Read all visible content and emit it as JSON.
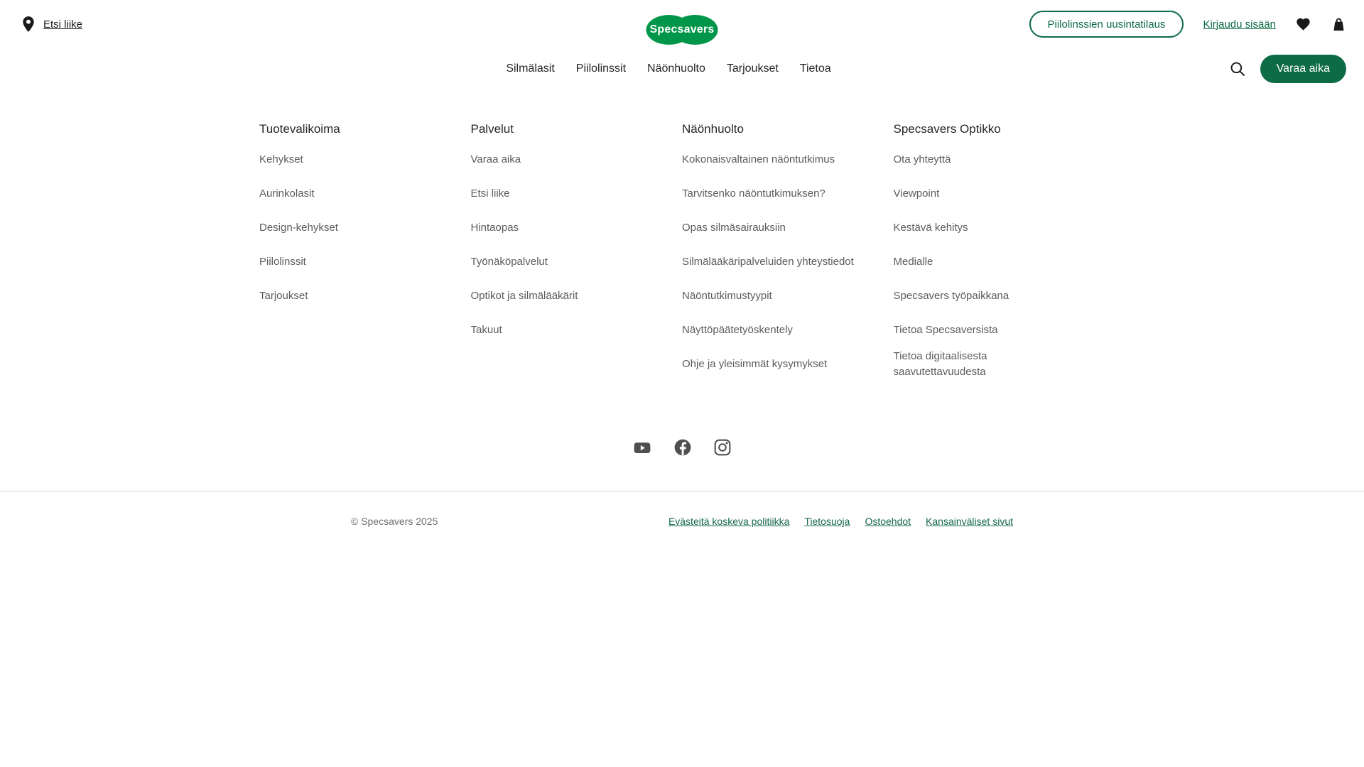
{
  "header": {
    "store_finder_label": "Etsi liike",
    "logo_text": "Specsavers",
    "reorder_button_label": "Piilolinssien uusintatilaus",
    "login_label": "Kirjaudu sisään",
    "nav_items": [
      "Silmälasit",
      "Piilolinssit",
      "Näönhuolto",
      "Tarjoukset",
      "Tietoa"
    ],
    "book_button_label": "Varaa aika"
  },
  "footer": {
    "columns": [
      {
        "title": "Tuotevalikoima",
        "links": [
          "Kehykset",
          "Aurinkolasit",
          "Design-kehykset",
          "Piilolinssit",
          "Tarjoukset"
        ]
      },
      {
        "title": "Palvelut",
        "links": [
          "Varaa aika",
          "Etsi liike",
          "Hintaopas",
          "Työnäköpalvelut",
          "Optikot ja silmälääkärit",
          "Takuut"
        ]
      },
      {
        "title": "Näönhuolto",
        "links": [
          "Kokonaisvaltainen näöntutkimus",
          "Tarvitsenko näöntutkimuksen?",
          "Opas silmäsairauksiin",
          "Silmälääkäripalveluiden yhteystiedot",
          "Näöntutkimustyypit",
          "Näyttöpäätetyöskentely",
          "Ohje ja yleisimmät kysymykset"
        ]
      },
      {
        "title": "Specsavers Optikko",
        "links": [
          "Ota yhteyttä",
          "Viewpoint",
          "Kestävä kehitys",
          "Medialle",
          "Specsavers työpaikkana",
          "Tietoa Specsaversista",
          "Tietoa digitaalisesta saavutettavuudesta"
        ]
      }
    ],
    "social_icons": [
      "youtube",
      "facebook",
      "instagram"
    ],
    "copyright": "© Specsavers 2025",
    "legal_links": [
      "Evästeitä koskeva politiikka",
      "Tietosuoja",
      "Ostoehdot",
      "Kansainväliset sivut"
    ]
  },
  "colors": {
    "brand_green": "#009649",
    "action_green": "#0d6b45",
    "legal_link_green": "#15694a",
    "text_dark": "#262626",
    "footer_link_gray": "#5c5c5c",
    "copyright_gray": "#6e6e6e",
    "divider_gray": "#d6d6d6",
    "icon_gray": "#4f4f4f"
  }
}
